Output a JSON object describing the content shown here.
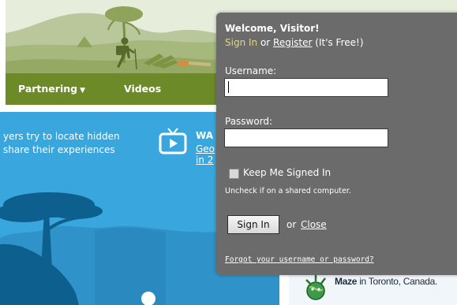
{
  "header": {
    "nav": [
      {
        "label": "Partnering",
        "caret": "▼"
      },
      {
        "label": "Videos"
      }
    ],
    "colors": {
      "nav_bar": "#6d8a28",
      "sky": "#e6eddb"
    }
  },
  "hero": {
    "text_line1": "yers try to locate hidden",
    "text_line2": "share their experiences",
    "watch": {
      "title": "WA",
      "link_line1": "Geo",
      "link_line2": "in 2",
      "icon": "tv-play-icon"
    },
    "background": "#39a7dd"
  },
  "sidebar_right": {
    "maze_name": "Maze",
    "maze_location": " in Toronto, Canada."
  },
  "login": {
    "welcome": "Welcome, Visitor!",
    "signin_link": "Sign In",
    "or_text1": " or ",
    "register_link": "Register",
    "free_text": " (It's Free!)",
    "username_label": "Username:",
    "username_value": "",
    "password_label": "Password:",
    "password_value": "",
    "keep_signed_in": "Keep Me Signed In",
    "uncheck_note": "Uncheck if on a shared computer.",
    "signin_button": "Sign In",
    "or_text2": "or",
    "close_link": "Close",
    "forgot_link": "Forgot your username or password?"
  }
}
